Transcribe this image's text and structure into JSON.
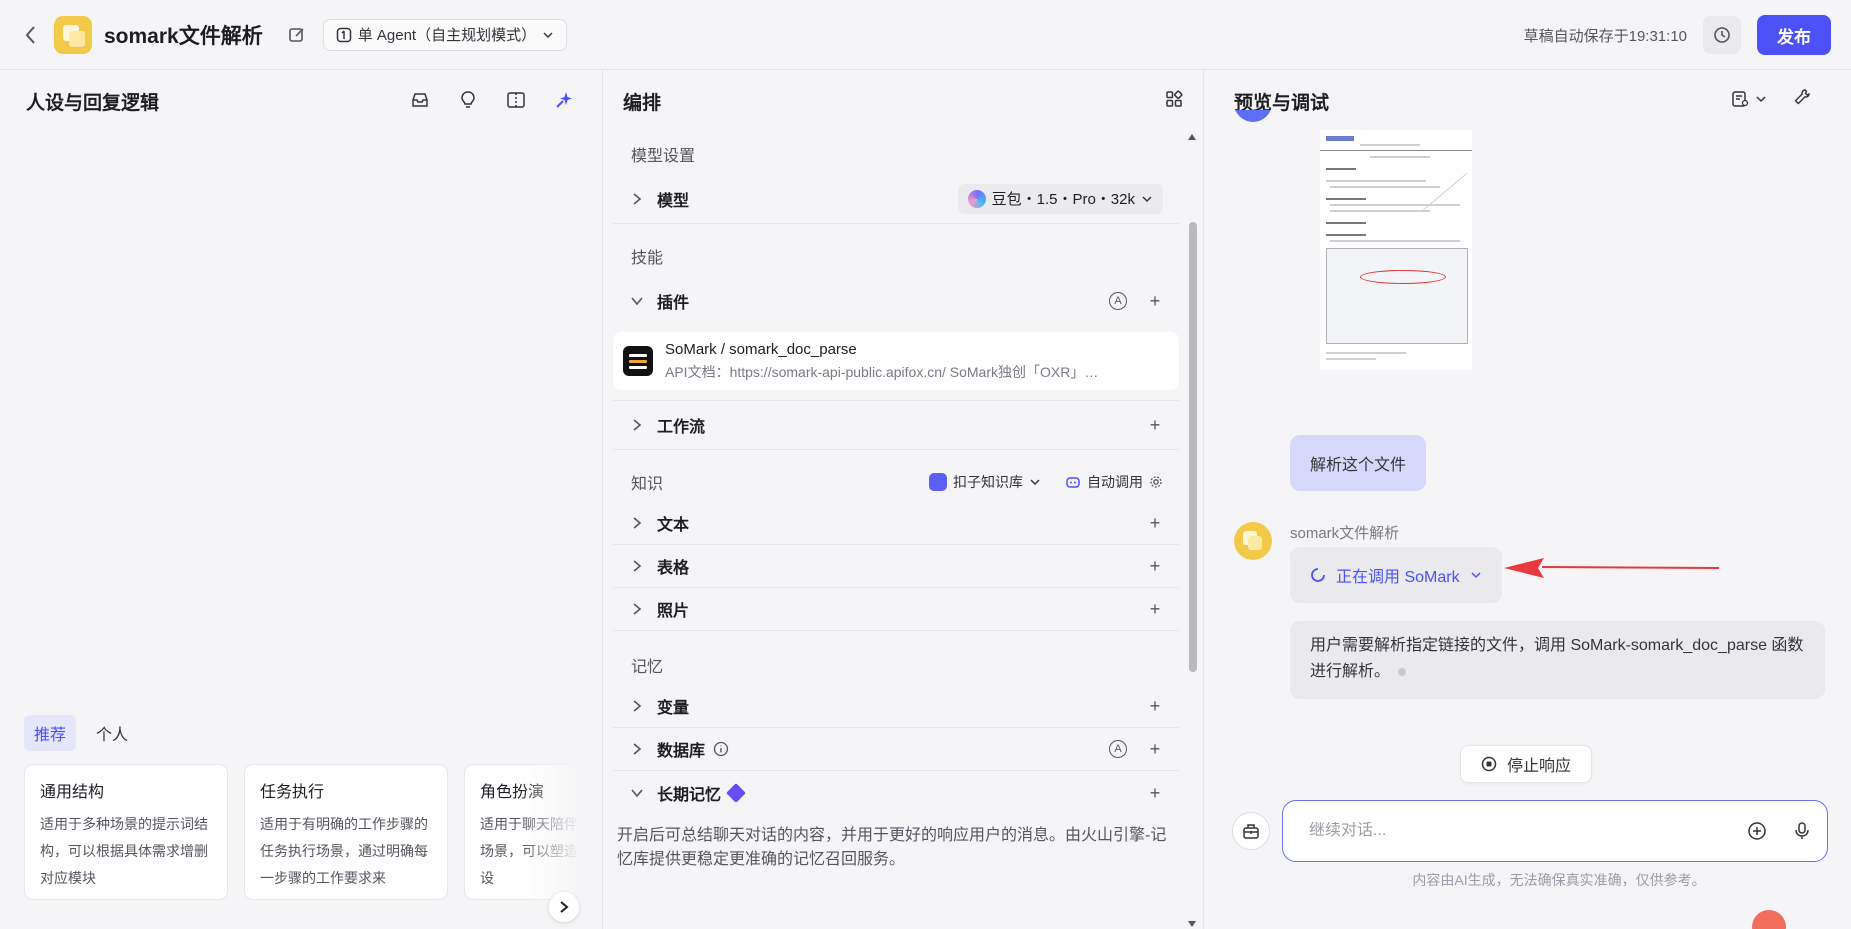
{
  "header": {
    "app_name": "somark文件解析",
    "mode_label": "单 Agent（自主规划模式）",
    "autosave": "草稿自动保存于19:31:10",
    "publish_label": "发布"
  },
  "left": {
    "title": "人设与回复逻辑",
    "tabs": [
      {
        "label": "推荐",
        "active": true
      },
      {
        "label": "个人",
        "active": false
      }
    ],
    "templates": [
      {
        "title": "通用结构",
        "desc": "适用于多种场景的提示词结构，可以根据具体需求增删对应模块"
      },
      {
        "title": "任务执行",
        "desc": "适用于有明确的工作步骤的任务执行场景，通过明确每一步骤的工作要求来"
      },
      {
        "title": "角色扮演",
        "desc": "适用于聊天陪伴、互动娱乐场景，可以塑造个性化的人设"
      }
    ]
  },
  "middle": {
    "title": "编排",
    "model_section": "模型设置",
    "model_label": "模型",
    "model_value": "豆包・1.5・Pro・32k",
    "skills_section": "技能",
    "plugins_label": "插件",
    "plugin": {
      "name": "SoMark / somark_doc_parse",
      "desc": "API文档：https://somark-api-public.apifox.cn/ SoMark独创「OXR」…"
    },
    "workflow_label": "工作流",
    "knowledge_section": "知识",
    "kb_select": "扣子知识库",
    "auto_call": "自动调用",
    "text_label": "文本",
    "table_label": "表格",
    "photo_label": "照片",
    "memory_section": "记忆",
    "variable_label": "变量",
    "database_label": "数据库",
    "longterm_label": "长期记忆",
    "memory_desc": "开启后可总结聊天对话的内容，并用于更好的响应用户的消息。由火山引擎-记忆库提供更稳定更准确的记忆召回服务。",
    "circle_a": "A"
  },
  "right": {
    "title": "预览与调试",
    "user_message": "解析这个文件",
    "bot_name": "somark文件解析",
    "calling_text": "正在调用 SoMark",
    "bot_message": "用户需要解析指定链接的文件，调用 SoMark-somark_doc_parse 函数进行解析。",
    "stop_label": "停止响应",
    "input_placeholder": "继续对话...",
    "disclaimer": "内容由AI生成，无法确保真实准确，仅供参考。"
  },
  "colors": {
    "accent": "#4c51f5",
    "user_bubble": "#d6d8fb",
    "arrow": "#e8393d"
  }
}
